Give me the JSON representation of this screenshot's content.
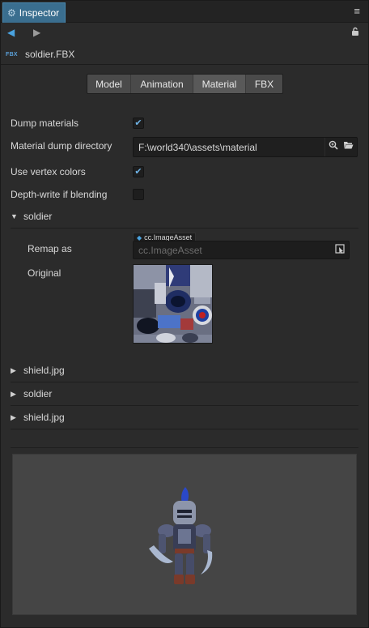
{
  "titlebar": {
    "tab_label": "Inspector",
    "tab_icon": "gear-icon",
    "menu_icon": "hamburger-menu-icon"
  },
  "nav": {
    "back_icon": "arrow-left-icon",
    "forward_icon": "arrow-right-icon",
    "lock_icon": "lock-icon"
  },
  "asset": {
    "badge": "FBX",
    "name": "soldier.FBX"
  },
  "tabs": [
    {
      "label": "Model",
      "selected": false
    },
    {
      "label": "Animation",
      "selected": false
    },
    {
      "label": "Material",
      "selected": true
    },
    {
      "label": "FBX",
      "selected": false
    }
  ],
  "properties": {
    "dump_materials": {
      "label": "Dump materials",
      "checked": true
    },
    "material_dump_directory": {
      "label": "Material dump directory",
      "value": "F:\\world340\\assets\\material"
    },
    "use_vertex_colors": {
      "label": "Use vertex colors",
      "checked": true
    },
    "depth_write_if_blending": {
      "label": "Depth-write if blending",
      "checked": false
    }
  },
  "material_section": {
    "title": "soldier",
    "expanded": true,
    "remap_label": "Remap as",
    "remap_tag": "cc.ImageAsset",
    "remap_placeholder": "cc.ImageAsset",
    "original_label": "Original"
  },
  "collapsed_sections": [
    {
      "title": "shield.jpg"
    },
    {
      "title": "soldier"
    },
    {
      "title": "shield.jpg"
    }
  ],
  "colors": {
    "accent": "#4aa3e0",
    "tab_active": "#3a6e8f",
    "background": "#2b2b2b",
    "preview_bg": "#454545"
  }
}
